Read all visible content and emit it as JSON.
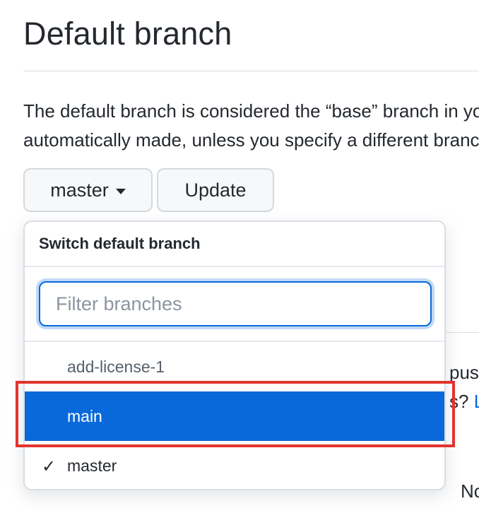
{
  "section": {
    "title": "Default branch",
    "description_line1": "The default branch is considered the “base” branch in your repository, against which all pull requests and code commits are",
    "description_line2": "automatically made, unless you specify a different branch."
  },
  "controls": {
    "branch_button_label": "master",
    "update_button_label": "Update"
  },
  "dropdown": {
    "header": "Switch default branch",
    "filter_placeholder": "Filter branches",
    "filter_value": "",
    "items": [
      {
        "label": "add-license-1",
        "selected": false,
        "current": false
      },
      {
        "label": "main",
        "selected": true,
        "current": false
      },
      {
        "label": "master",
        "selected": false,
        "current": true
      }
    ],
    "current_check_glyph": "✓"
  },
  "background_fragments": {
    "frag_pus": "pus",
    "frag_s": "s?",
    "frag_link": "L",
    "frag_no": "No"
  },
  "colors": {
    "accent": "#0969da",
    "highlight_annotation": "#e2342d"
  }
}
